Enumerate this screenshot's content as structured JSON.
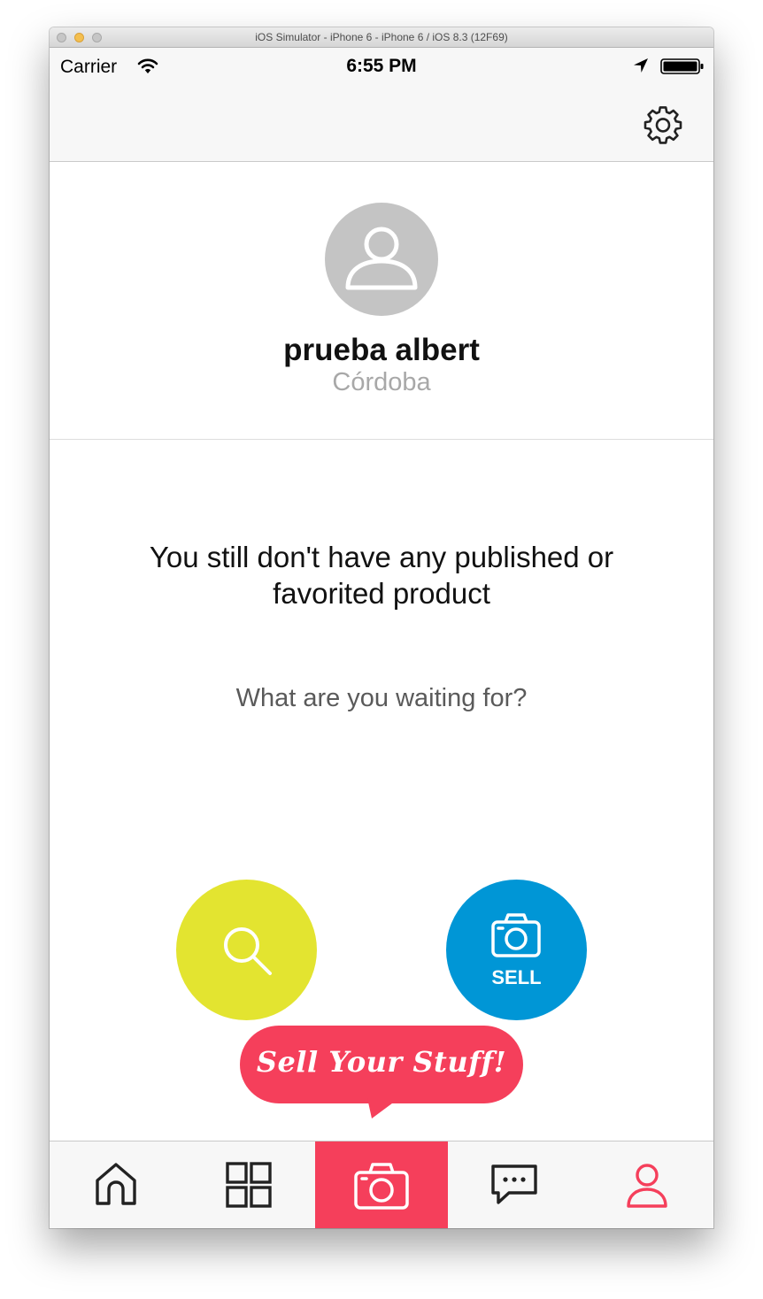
{
  "window": {
    "title": "iOS Simulator - iPhone 6 - iPhone 6 / iOS 8.3 (12F69)"
  },
  "status_bar": {
    "carrier": "Carrier",
    "time": "6:55 PM"
  },
  "navbar": {
    "settings_icon": "gear-icon"
  },
  "profile": {
    "name": "prueba albert",
    "location": "Córdoba",
    "avatar_icon": "user-placeholder-icon"
  },
  "empty_state": {
    "message": "You still don't have any published or favorited product",
    "prompt": "What are you waiting for?"
  },
  "actions": {
    "search_icon": "search-icon",
    "sell_label": "SELL",
    "sell_icon": "camera-icon",
    "bubble_text": "Sell Your Stuff!"
  },
  "tabs": [
    {
      "name": "home",
      "icon": "home-icon",
      "active": false
    },
    {
      "name": "categories",
      "icon": "grid-icon",
      "active": false
    },
    {
      "name": "sell",
      "icon": "camera-icon",
      "active": true
    },
    {
      "name": "chats",
      "icon": "chat-icon",
      "active": false
    },
    {
      "name": "profile",
      "icon": "user-icon",
      "active": false
    }
  ],
  "colors": {
    "accent": "#f53f5b",
    "search_button": "#e3e430",
    "sell_button": "#0096d6",
    "location_text": "#a8a8a8"
  }
}
